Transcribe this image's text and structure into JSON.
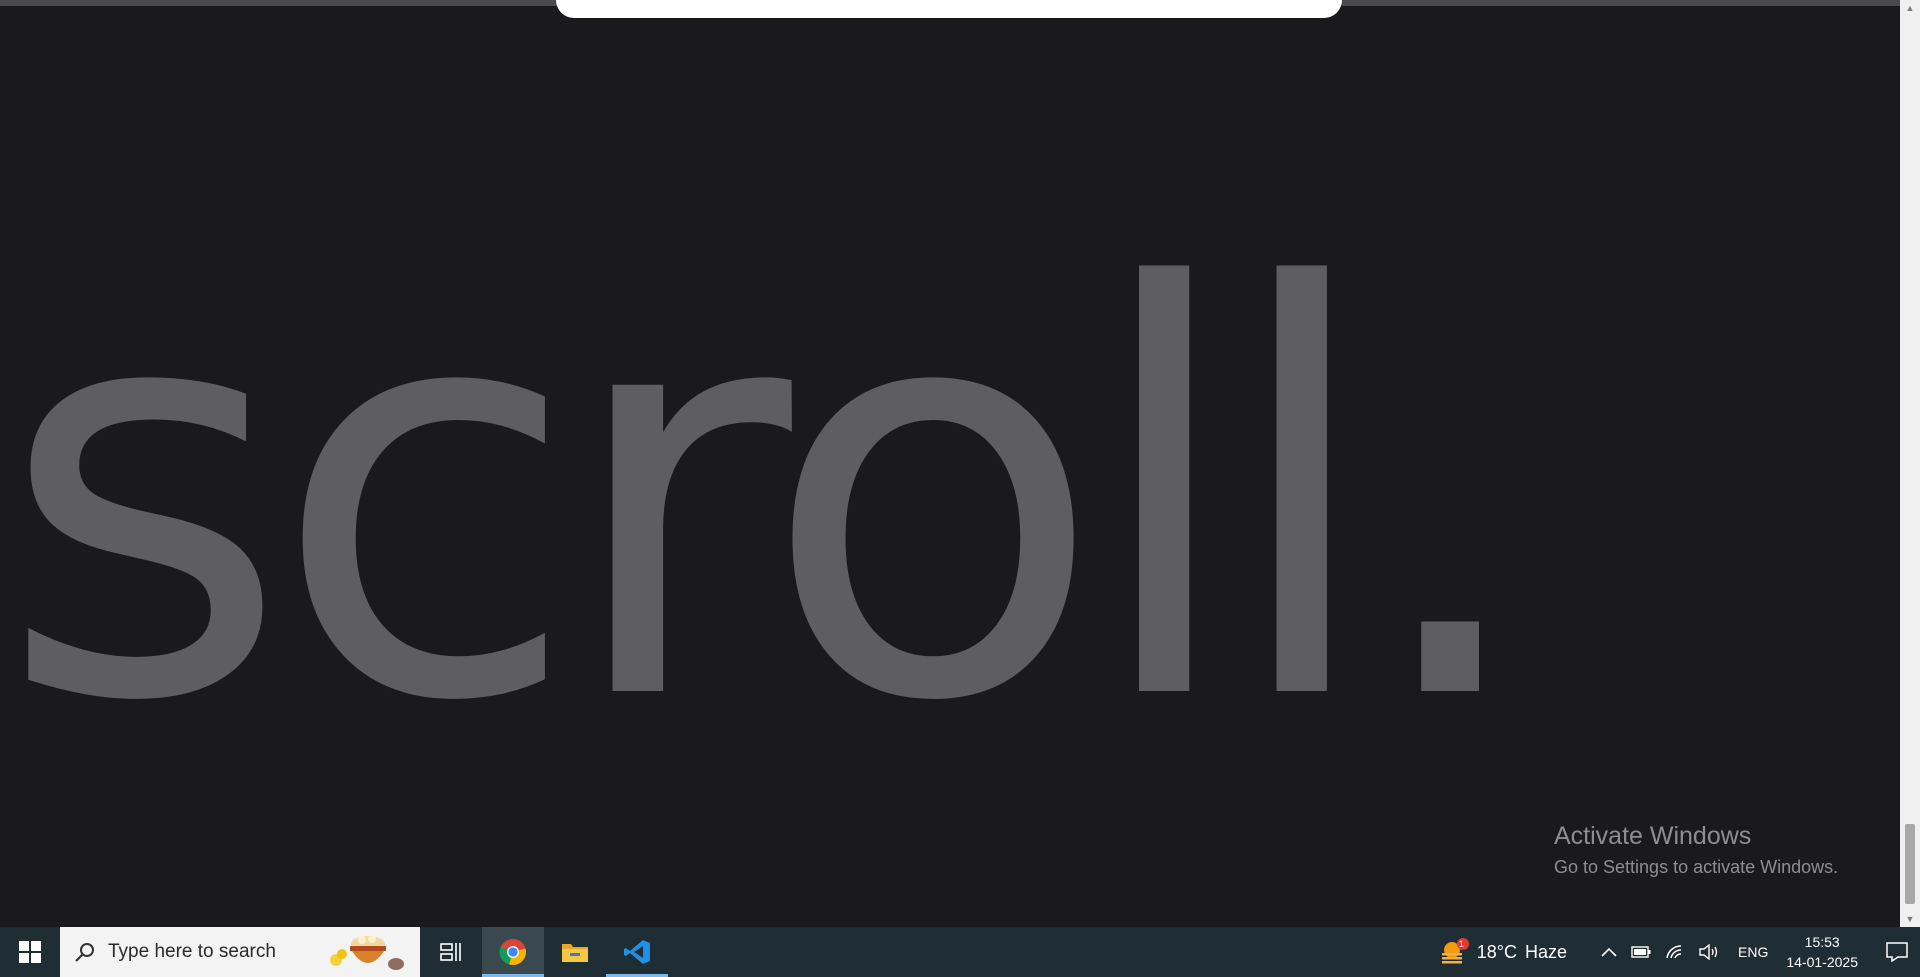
{
  "page": {
    "hero_word": "scroll."
  },
  "watermark": {
    "title": "Activate Windows",
    "subtitle": "Go to Settings to activate Windows."
  },
  "taskbar": {
    "search_placeholder": "Type here to search",
    "apps": [
      {
        "name": "Google Chrome",
        "icon": "chrome-icon",
        "active": true
      },
      {
        "name": "File Explorer",
        "icon": "folder-icon",
        "active": false
      },
      {
        "name": "Visual Studio Code",
        "icon": "vscode-icon",
        "active": false
      }
    ],
    "weather": {
      "temp": "18°C",
      "condition": "Haze",
      "badge": "1"
    },
    "language": "ENG",
    "clock": {
      "time": "15:53",
      "date": "14-01-2025"
    }
  },
  "colors": {
    "background": "#1a1a1c",
    "hero_text": "#5e5e60",
    "taskbar": "#1f2d35",
    "accent": "#79b8e8"
  }
}
